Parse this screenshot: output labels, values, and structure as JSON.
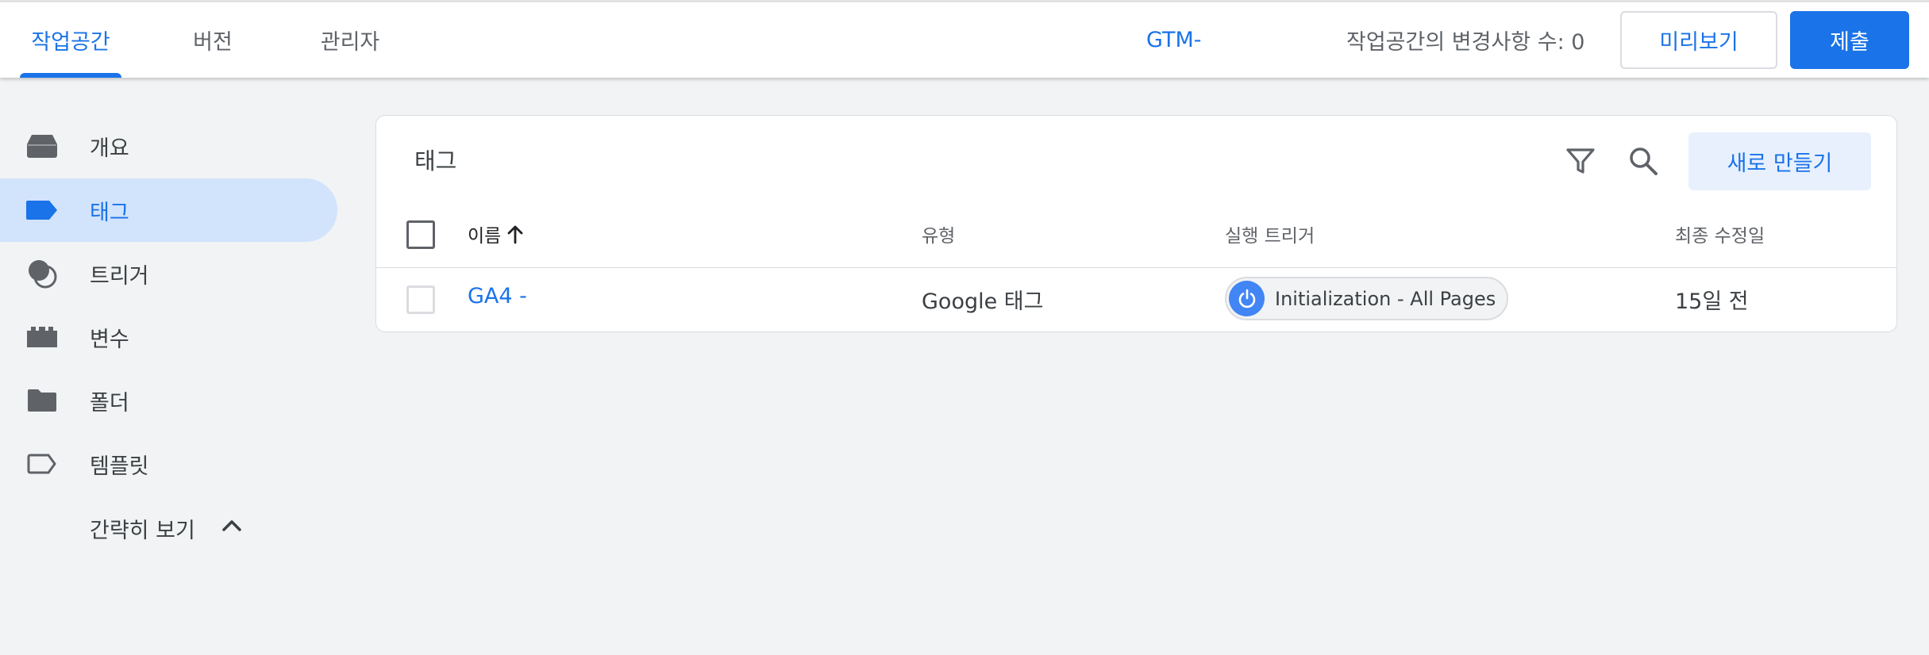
{
  "topbar": {
    "tabs": [
      {
        "label": "작업공간",
        "active": true
      },
      {
        "label": "버전",
        "active": false
      },
      {
        "label": "관리자",
        "active": false
      }
    ],
    "container_id": "GTM-",
    "changes_label": "작업공간의 변경사항 수: 0",
    "preview_label": "미리보기",
    "submit_label": "제출"
  },
  "sidebar": {
    "items": [
      {
        "label": "개요",
        "icon": "overview-icon"
      },
      {
        "label": "태그",
        "icon": "tag-icon",
        "active": true
      },
      {
        "label": "트리거",
        "icon": "trigger-icon"
      },
      {
        "label": "변수",
        "icon": "variable-icon"
      },
      {
        "label": "폴더",
        "icon": "folder-icon"
      },
      {
        "label": "템플릿",
        "icon": "template-icon"
      }
    ],
    "collapse_label": "간략히 보기"
  },
  "card": {
    "title": "태그",
    "new_label": "새로 만들기",
    "columns": {
      "name": "이름",
      "type": "유형",
      "trigger": "실행 트리거",
      "modified": "최종 수정일"
    },
    "rows": [
      {
        "name": "GA4 -",
        "type": "Google 태그",
        "trigger": "Initialization - All Pages",
        "modified": "15일 전"
      }
    ]
  },
  "colors": {
    "accent": "#1a73e8",
    "active_nav_bg": "#d2e3fc",
    "page_bg": "#f1f3f4"
  }
}
